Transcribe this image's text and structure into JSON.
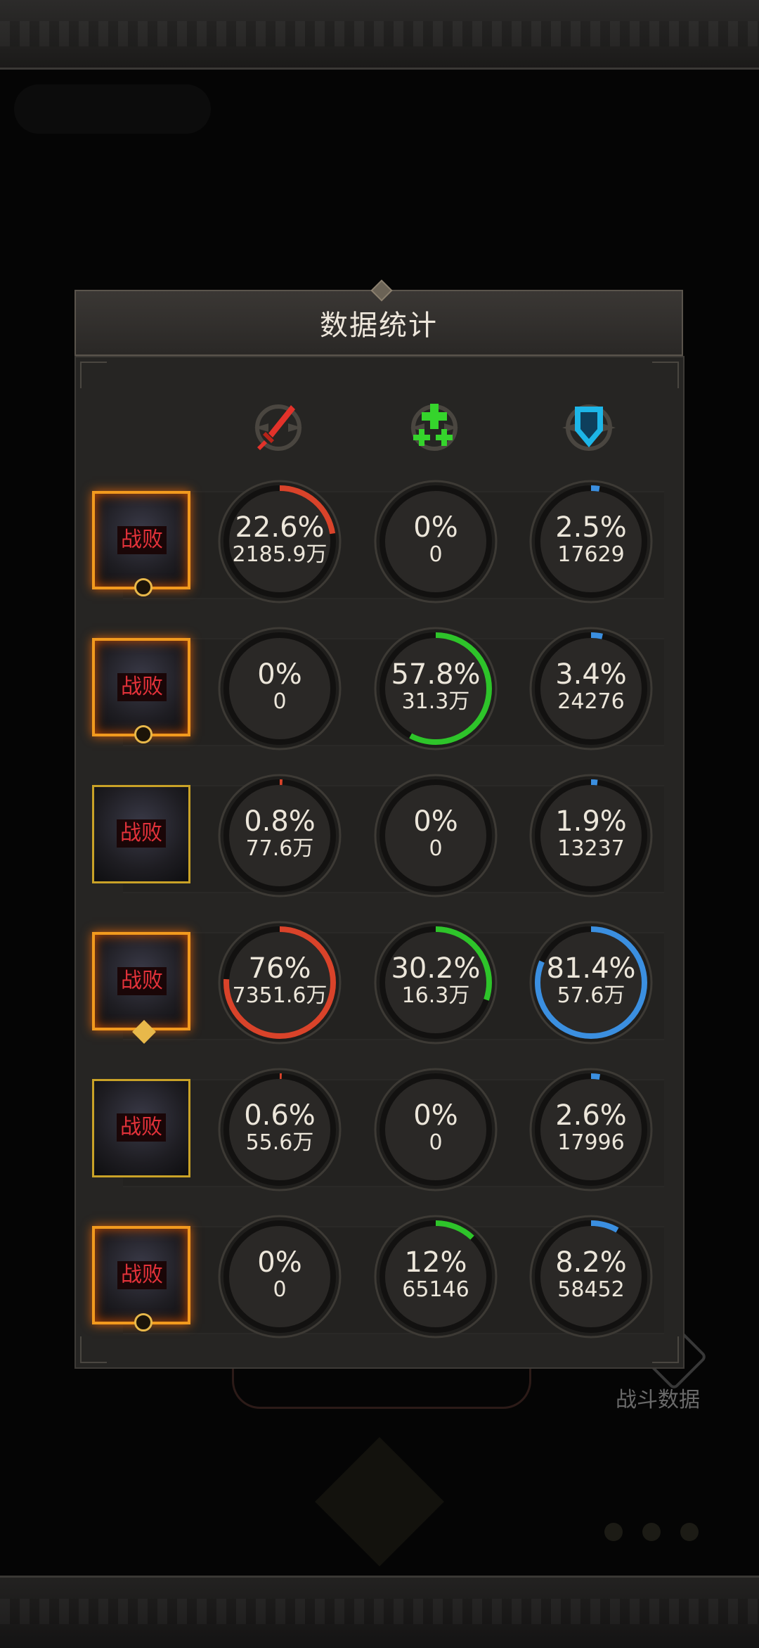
{
  "panel": {
    "title": "数据统计"
  },
  "columns": [
    {
      "name": "damage",
      "icon": "red-sword-icon",
      "color": "#d9432a"
    },
    {
      "name": "heal",
      "icon": "green-cross-icon",
      "color": "#2ec42a"
    },
    {
      "name": "damage-taken",
      "icon": "blue-shield-icon",
      "color": "#3b8fe0"
    }
  ],
  "colors": {
    "damage": "#d9432a",
    "heal": "#2ec42a",
    "shield": "#3b8fe0",
    "defeat_text": "#e3323a",
    "panel_bg": "#262523"
  },
  "rows": [
    {
      "defeat_label": "战败",
      "frame": "orange",
      "badge": "moon",
      "stats": [
        {
          "pct": "22.6%",
          "value": "2185.9万",
          "fraction": 0.226
        },
        {
          "pct": "0%",
          "value": "0",
          "fraction": 0
        },
        {
          "pct": "2.5%",
          "value": "17629",
          "fraction": 0.025
        }
      ]
    },
    {
      "defeat_label": "战败",
      "frame": "orange",
      "badge": "moon",
      "stats": [
        {
          "pct": "0%",
          "value": "0",
          "fraction": 0
        },
        {
          "pct": "57.8%",
          "value": "31.3万",
          "fraction": 0.578
        },
        {
          "pct": "3.4%",
          "value": "24276",
          "fraction": 0.034
        }
      ]
    },
    {
      "defeat_label": "战败",
      "frame": "gold",
      "badge": "none",
      "stats": [
        {
          "pct": "0.8%",
          "value": "77.6万",
          "fraction": 0.008
        },
        {
          "pct": "0%",
          "value": "0",
          "fraction": 0
        },
        {
          "pct": "1.9%",
          "value": "13237",
          "fraction": 0.019
        }
      ]
    },
    {
      "defeat_label": "战败",
      "frame": "orange",
      "badge": "sun",
      "stats": [
        {
          "pct": "76%",
          "value": "7351.6万",
          "fraction": 0.76
        },
        {
          "pct": "30.2%",
          "value": "16.3万",
          "fraction": 0.302
        },
        {
          "pct": "81.4%",
          "value": "57.6万",
          "fraction": 0.814
        }
      ]
    },
    {
      "defeat_label": "战败",
      "frame": "gold",
      "badge": "none",
      "stats": [
        {
          "pct": "0.6%",
          "value": "55.6万",
          "fraction": 0.006
        },
        {
          "pct": "0%",
          "value": "0",
          "fraction": 0
        },
        {
          "pct": "2.6%",
          "value": "17996",
          "fraction": 0.026
        }
      ]
    },
    {
      "defeat_label": "战败",
      "frame": "orange",
      "badge": "moon",
      "stats": [
        {
          "pct": "0%",
          "value": "0",
          "fraction": 0
        },
        {
          "pct": "12%",
          "value": "65146",
          "fraction": 0.12
        },
        {
          "pct": "8.2%",
          "value": "58452",
          "fraction": 0.082
        }
      ]
    }
  ],
  "background": {
    "battle_data_label": "战斗数据"
  }
}
